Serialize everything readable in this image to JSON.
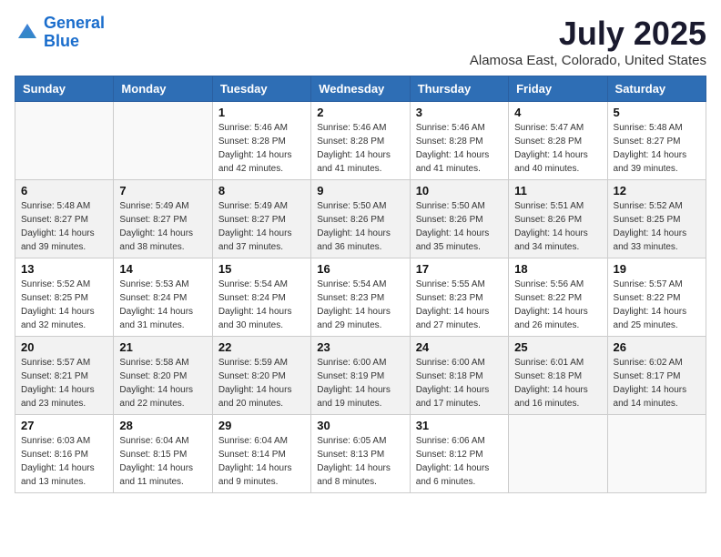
{
  "logo": {
    "line1": "General",
    "line2": "Blue"
  },
  "title": "July 2025",
  "subtitle": "Alamosa East, Colorado, United States",
  "days_of_week": [
    "Sunday",
    "Monday",
    "Tuesday",
    "Wednesday",
    "Thursday",
    "Friday",
    "Saturday"
  ],
  "weeks": [
    [
      {
        "day": "",
        "sunrise": "",
        "sunset": "",
        "daylight": ""
      },
      {
        "day": "",
        "sunrise": "",
        "sunset": "",
        "daylight": ""
      },
      {
        "day": "1",
        "sunrise": "Sunrise: 5:46 AM",
        "sunset": "Sunset: 8:28 PM",
        "daylight": "Daylight: 14 hours and 42 minutes."
      },
      {
        "day": "2",
        "sunrise": "Sunrise: 5:46 AM",
        "sunset": "Sunset: 8:28 PM",
        "daylight": "Daylight: 14 hours and 41 minutes."
      },
      {
        "day": "3",
        "sunrise": "Sunrise: 5:46 AM",
        "sunset": "Sunset: 8:28 PM",
        "daylight": "Daylight: 14 hours and 41 minutes."
      },
      {
        "day": "4",
        "sunrise": "Sunrise: 5:47 AM",
        "sunset": "Sunset: 8:28 PM",
        "daylight": "Daylight: 14 hours and 40 minutes."
      },
      {
        "day": "5",
        "sunrise": "Sunrise: 5:48 AM",
        "sunset": "Sunset: 8:27 PM",
        "daylight": "Daylight: 14 hours and 39 minutes."
      }
    ],
    [
      {
        "day": "6",
        "sunrise": "Sunrise: 5:48 AM",
        "sunset": "Sunset: 8:27 PM",
        "daylight": "Daylight: 14 hours and 39 minutes."
      },
      {
        "day": "7",
        "sunrise": "Sunrise: 5:49 AM",
        "sunset": "Sunset: 8:27 PM",
        "daylight": "Daylight: 14 hours and 38 minutes."
      },
      {
        "day": "8",
        "sunrise": "Sunrise: 5:49 AM",
        "sunset": "Sunset: 8:27 PM",
        "daylight": "Daylight: 14 hours and 37 minutes."
      },
      {
        "day": "9",
        "sunrise": "Sunrise: 5:50 AM",
        "sunset": "Sunset: 8:26 PM",
        "daylight": "Daylight: 14 hours and 36 minutes."
      },
      {
        "day": "10",
        "sunrise": "Sunrise: 5:50 AM",
        "sunset": "Sunset: 8:26 PM",
        "daylight": "Daylight: 14 hours and 35 minutes."
      },
      {
        "day": "11",
        "sunrise": "Sunrise: 5:51 AM",
        "sunset": "Sunset: 8:26 PM",
        "daylight": "Daylight: 14 hours and 34 minutes."
      },
      {
        "day": "12",
        "sunrise": "Sunrise: 5:52 AM",
        "sunset": "Sunset: 8:25 PM",
        "daylight": "Daylight: 14 hours and 33 minutes."
      }
    ],
    [
      {
        "day": "13",
        "sunrise": "Sunrise: 5:52 AM",
        "sunset": "Sunset: 8:25 PM",
        "daylight": "Daylight: 14 hours and 32 minutes."
      },
      {
        "day": "14",
        "sunrise": "Sunrise: 5:53 AM",
        "sunset": "Sunset: 8:24 PM",
        "daylight": "Daylight: 14 hours and 31 minutes."
      },
      {
        "day": "15",
        "sunrise": "Sunrise: 5:54 AM",
        "sunset": "Sunset: 8:24 PM",
        "daylight": "Daylight: 14 hours and 30 minutes."
      },
      {
        "day": "16",
        "sunrise": "Sunrise: 5:54 AM",
        "sunset": "Sunset: 8:23 PM",
        "daylight": "Daylight: 14 hours and 29 minutes."
      },
      {
        "day": "17",
        "sunrise": "Sunrise: 5:55 AM",
        "sunset": "Sunset: 8:23 PM",
        "daylight": "Daylight: 14 hours and 27 minutes."
      },
      {
        "day": "18",
        "sunrise": "Sunrise: 5:56 AM",
        "sunset": "Sunset: 8:22 PM",
        "daylight": "Daylight: 14 hours and 26 minutes."
      },
      {
        "day": "19",
        "sunrise": "Sunrise: 5:57 AM",
        "sunset": "Sunset: 8:22 PM",
        "daylight": "Daylight: 14 hours and 25 minutes."
      }
    ],
    [
      {
        "day": "20",
        "sunrise": "Sunrise: 5:57 AM",
        "sunset": "Sunset: 8:21 PM",
        "daylight": "Daylight: 14 hours and 23 minutes."
      },
      {
        "day": "21",
        "sunrise": "Sunrise: 5:58 AM",
        "sunset": "Sunset: 8:20 PM",
        "daylight": "Daylight: 14 hours and 22 minutes."
      },
      {
        "day": "22",
        "sunrise": "Sunrise: 5:59 AM",
        "sunset": "Sunset: 8:20 PM",
        "daylight": "Daylight: 14 hours and 20 minutes."
      },
      {
        "day": "23",
        "sunrise": "Sunrise: 6:00 AM",
        "sunset": "Sunset: 8:19 PM",
        "daylight": "Daylight: 14 hours and 19 minutes."
      },
      {
        "day": "24",
        "sunrise": "Sunrise: 6:00 AM",
        "sunset": "Sunset: 8:18 PM",
        "daylight": "Daylight: 14 hours and 17 minutes."
      },
      {
        "day": "25",
        "sunrise": "Sunrise: 6:01 AM",
        "sunset": "Sunset: 8:18 PM",
        "daylight": "Daylight: 14 hours and 16 minutes."
      },
      {
        "day": "26",
        "sunrise": "Sunrise: 6:02 AM",
        "sunset": "Sunset: 8:17 PM",
        "daylight": "Daylight: 14 hours and 14 minutes."
      }
    ],
    [
      {
        "day": "27",
        "sunrise": "Sunrise: 6:03 AM",
        "sunset": "Sunset: 8:16 PM",
        "daylight": "Daylight: 14 hours and 13 minutes."
      },
      {
        "day": "28",
        "sunrise": "Sunrise: 6:04 AM",
        "sunset": "Sunset: 8:15 PM",
        "daylight": "Daylight: 14 hours and 11 minutes."
      },
      {
        "day": "29",
        "sunrise": "Sunrise: 6:04 AM",
        "sunset": "Sunset: 8:14 PM",
        "daylight": "Daylight: 14 hours and 9 minutes."
      },
      {
        "day": "30",
        "sunrise": "Sunrise: 6:05 AM",
        "sunset": "Sunset: 8:13 PM",
        "daylight": "Daylight: 14 hours and 8 minutes."
      },
      {
        "day": "31",
        "sunrise": "Sunrise: 6:06 AM",
        "sunset": "Sunset: 8:12 PM",
        "daylight": "Daylight: 14 hours and 6 minutes."
      },
      {
        "day": "",
        "sunrise": "",
        "sunset": "",
        "daylight": ""
      },
      {
        "day": "",
        "sunrise": "",
        "sunset": "",
        "daylight": ""
      }
    ]
  ]
}
